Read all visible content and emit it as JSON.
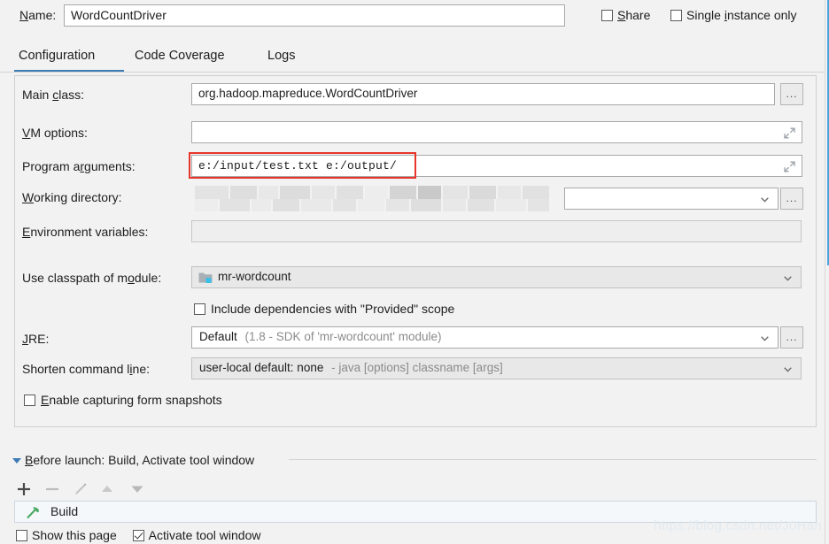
{
  "window": {
    "accent_color": "#3d7bb5",
    "annotation_color": "#e8352b",
    "watermark": "https://blog.csdn.net/J0Han"
  },
  "name_row": {
    "label": "Name:",
    "value": "WordCountDriver",
    "share_label": "Share",
    "share_checked": false,
    "single_instance_label": "Single instance only",
    "single_instance_checked": false
  },
  "tabs": [
    {
      "label": "Configuration",
      "selected": true
    },
    {
      "label": "Code Coverage",
      "selected": false
    },
    {
      "label": "Logs",
      "selected": false
    }
  ],
  "fields": {
    "main_class": {
      "label": "Main class:",
      "value": "org.hadoop.mapreduce.WordCountDriver",
      "browse_label": "..."
    },
    "vm_options": {
      "label": "VM options:",
      "value": "",
      "expand_icon": "expand-icon"
    },
    "program_arguments": {
      "label": "Program arguments:",
      "value": "e:/input/test.txt e:/output/",
      "expand_icon": "expand-icon",
      "highlighted": true
    },
    "working_directory": {
      "label": "Working directory:",
      "value": "",
      "redacted": true,
      "browse_label": "..."
    },
    "environment_variables": {
      "label": "Environment variables:",
      "value": "",
      "browse_icon": "folder-icon"
    },
    "use_classpath_of_module": {
      "label": "Use classpath of module:",
      "value": "mr-wordcount",
      "icon": "module-folder-icon"
    },
    "include_provided": {
      "label": "Include dependencies with \"Provided\" scope",
      "checked": false
    },
    "jre": {
      "label": "JRE:",
      "value": "Default",
      "value_hint": "(1.8 - SDK of 'mr-wordcount' module)",
      "browse_label": "..."
    },
    "shorten_command_line": {
      "label": "Shorten command line:",
      "value": "user-local default: none",
      "value_hint": "- java [options] classname [args]"
    },
    "enable_form_snapshots": {
      "label": "Enable capturing form snapshots",
      "checked": false
    }
  },
  "before_launch": {
    "header": "Before launch: Build, Activate tool window",
    "toolbar": [
      {
        "name": "add-icon",
        "glyph": "+"
      },
      {
        "name": "remove-icon",
        "glyph": "−"
      },
      {
        "name": "edit-pencil-icon",
        "glyph": "✎"
      },
      {
        "name": "move-up-icon",
        "glyph": "▲"
      },
      {
        "name": "move-down-icon",
        "glyph": "▼"
      }
    ],
    "items": [
      {
        "label": "Build",
        "icon": "build-hammer-icon"
      }
    ],
    "show_this_page": {
      "label": "Show this page",
      "checked": false
    },
    "activate_tool_window": {
      "label": "Activate tool window",
      "checked": true
    }
  }
}
